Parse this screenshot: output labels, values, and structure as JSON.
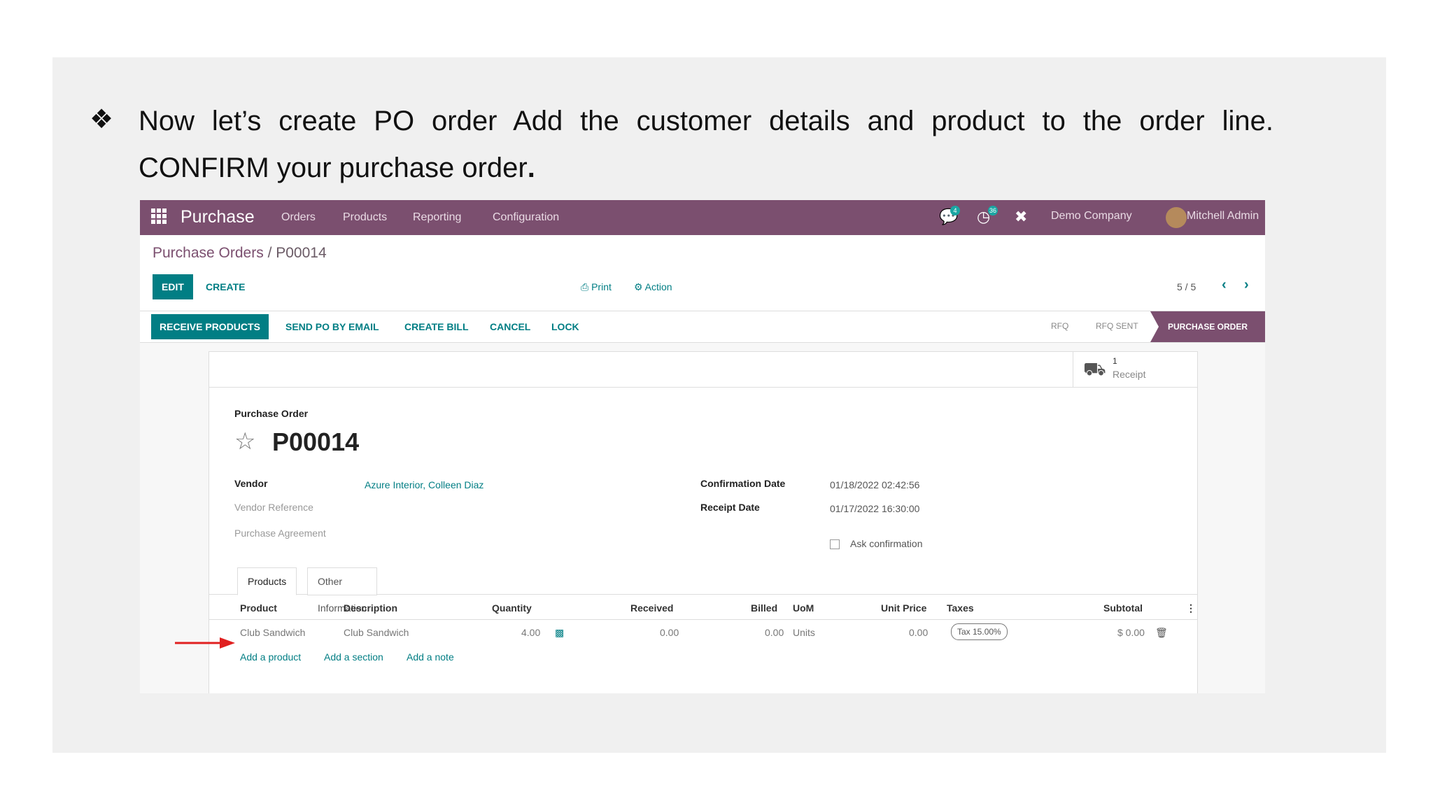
{
  "slide": {
    "bullet_glyph": "❖",
    "instruction_text": "Now let’s create PO order Add the customer details and product to the order line. CONFIRM your purchase order",
    "instruction_period": "."
  },
  "navbar": {
    "app_title": "Purchase",
    "menu": [
      "Orders",
      "Products",
      "Reporting",
      "Configuration"
    ],
    "messages_badge": "4",
    "activities_badge": "36",
    "company": "Demo Company",
    "user": "Mitchell Admin"
  },
  "control_panel": {
    "breadcrumb_parent": "Purchase Orders",
    "breadcrumb_sep": " / ",
    "breadcrumb_current": "P00014",
    "edit_label": "EDIT",
    "create_label": "CREATE",
    "print_label": "Print",
    "action_label": "Action",
    "pager": "5 / 5"
  },
  "statusbar": {
    "buttons": [
      "RECEIVE PRODUCTS",
      "SEND PO BY EMAIL",
      "CREATE BILL",
      "CANCEL",
      "LOCK"
    ],
    "stages": [
      "RFQ",
      "RFQ SENT",
      "PURCHASE ORDER"
    ]
  },
  "smart_button": {
    "count": "1",
    "label": "Receipt"
  },
  "form": {
    "doc_type": "Purchase Order",
    "name": "P00014",
    "vendor_label": "Vendor",
    "vendor_value": "Azure Interior, Colleen Diaz",
    "vendor_ref_label": "Vendor Reference",
    "agreement_label": "Purchase Agreement",
    "confirmation_date_label": "Confirmation Date",
    "confirmation_date_value": "01/18/2022 02:42:56",
    "receipt_date_label": "Receipt Date",
    "receipt_date_value": "01/17/2022 16:30:00",
    "ask_confirmation_label": "Ask confirmation"
  },
  "tabs": [
    "Products",
    "Other Information"
  ],
  "order_lines": {
    "columns": [
      "Product",
      "Description",
      "Quantity",
      "Received",
      "Billed",
      "UoM",
      "Unit Price",
      "Taxes",
      "Subtotal"
    ],
    "rows": [
      {
        "product": "Club Sandwich",
        "description": "Club Sandwich",
        "quantity": "4.00",
        "received": "0.00",
        "billed": "0.00",
        "uom": "Units",
        "unit_price": "0.00",
        "taxes": "Tax 15.00%",
        "subtotal": "$ 0.00"
      }
    ],
    "add_links": [
      "Add a product",
      "Add a section",
      "Add a note"
    ]
  },
  "colors": {
    "navbar": "#7b4f6f",
    "primary": "#017e84",
    "slide_bg": "#f0f0f0",
    "arrow": "#e02020"
  }
}
